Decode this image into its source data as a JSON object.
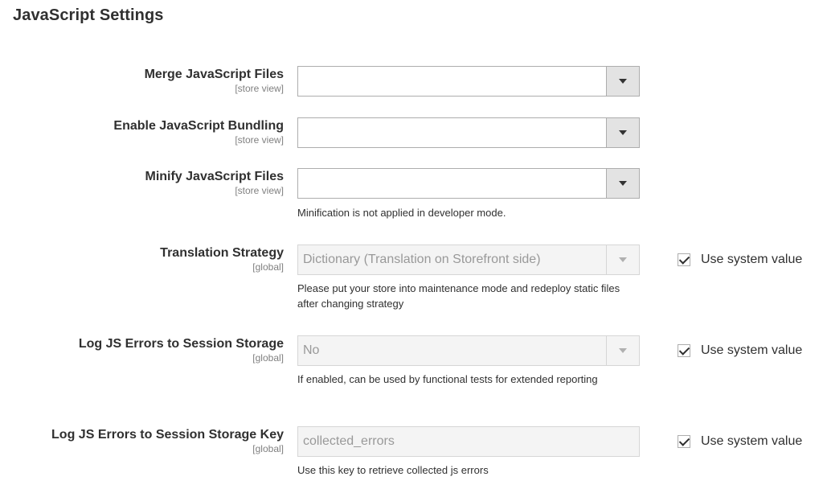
{
  "section": {
    "title": "JavaScript Settings"
  },
  "rows": [
    {
      "label": "Merge JavaScript Files",
      "scope": "[store view]",
      "value": "",
      "note": "",
      "use_system": ""
    },
    {
      "label": "Enable JavaScript Bundling",
      "scope": "[store view]",
      "value": "",
      "note": "",
      "use_system": ""
    },
    {
      "label": "Minify JavaScript Files",
      "scope": "[store view]",
      "value": "",
      "note": "Minification is not applied in developer mode.",
      "use_system": ""
    },
    {
      "label": "Translation Strategy",
      "scope": "[global]",
      "value": "Dictionary (Translation on Storefront side)",
      "note": "Please put your store into maintenance mode and redeploy static files after changing strategy",
      "use_system": "Use system value",
      "use_system_checked": true
    },
    {
      "label": "Log JS Errors to Session Storage",
      "scope": "[global]",
      "value": "No",
      "note": "If enabled, can be used by functional tests for extended reporting",
      "use_system": "Use system value",
      "use_system_checked": true
    },
    {
      "label": "Log JS Errors to Session Storage Key",
      "scope": "[global]",
      "value": "collected_errors",
      "note": "Use this key to retrieve collected js errors",
      "use_system": "Use system value",
      "use_system_checked": true
    }
  ],
  "icons": {
    "select_arrow": "chevron-down-icon",
    "checkbox": "checkmark-icon"
  },
  "colors": {
    "text": "#303030",
    "scope": "#808080",
    "border": "#adadad",
    "disabled_bg": "#f4f4f4",
    "select_button": "#e3e3e3"
  }
}
